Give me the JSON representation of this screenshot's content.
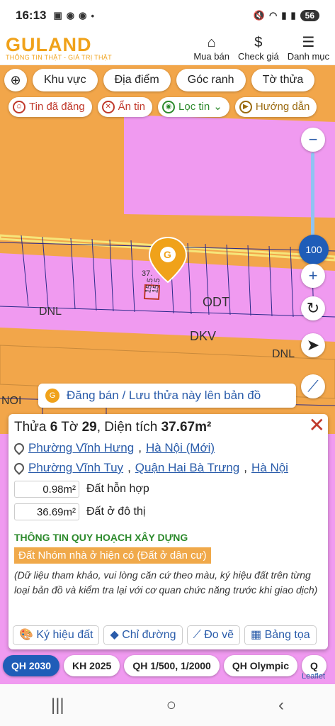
{
  "status": {
    "time": "16:13",
    "battery": "56"
  },
  "header": {
    "brand": "GULAND",
    "slogan": "THÔNG TIN THẬT - GIÁ TRỊ THẬT",
    "nav": [
      {
        "label": "Mua bán",
        "icon": "building-icon"
      },
      {
        "label": "Check giá",
        "icon": "dollar-icon"
      },
      {
        "label": "Danh mục",
        "icon": "menu-icon"
      }
    ]
  },
  "chips": [
    "Khu vực",
    "Địa điểm",
    "Góc ranh",
    "Tờ thửa"
  ],
  "chips2": [
    "Tin đã đăng",
    "Ẩn tin",
    "Lọc tin",
    "Hướng dẫn"
  ],
  "map": {
    "labels": {
      "odt": "ODT",
      "dkv": "DKV",
      "dnl1": "DNL",
      "dnl2": "DNL",
      "noi": "NOI",
      "dim1": "37.",
      "dim2": "15.5",
      "dim3": "15.5"
    },
    "zoom_value": "100"
  },
  "post_bar": "Đăng bán / Lưu thửa này lên bản đồ",
  "panel": {
    "title_prefix": "Thửa ",
    "parcel": "6",
    "sheet_prefix": " Tờ ",
    "sheet": "29",
    "area_prefix": ", Diện tích ",
    "area": "37.67m²",
    "addr1": {
      "ward": "Phường Vĩnh Hưng",
      "city": "Hà Nội (Mới)"
    },
    "addr2": {
      "ward": "Phường Vĩnh Tuy",
      "district": "Quận Hai Bà Trưng",
      "city": "Hà Nội"
    },
    "areas": [
      {
        "value": "0.98m²",
        "label": "Đất hỗn hợp"
      },
      {
        "value": "36.69m²",
        "label": "Đất ở đô thị"
      }
    ],
    "section_title": "THÔNG TIN QUY HOẠCH XÂY DỰNG",
    "land_type": "Đất Nhóm nhà ở hiện có (Đất ở dân cư)",
    "note": "(Dữ liệu tham khảo, vui lòng căn cứ theo màu, ký hiệu đất trên từng loại bản đồ và kiểm tra lại với cơ quan chức năng trước khi giao dịch)",
    "actions": [
      "Ký hiệu đất",
      "Chỉ đường",
      "Đo vẽ",
      "Bảng tọa"
    ]
  },
  "bottom_tabs": [
    "QH 2030",
    "KH 2025",
    "QH 1/500, 1/2000",
    "QH Olympic",
    "Q"
  ],
  "leaflet": "Leaflet",
  "colors": {
    "accent": "#1f5db8",
    "brand": "#f0a21a",
    "map_orange": "#f2a64a",
    "map_pink": "#f09af0"
  }
}
